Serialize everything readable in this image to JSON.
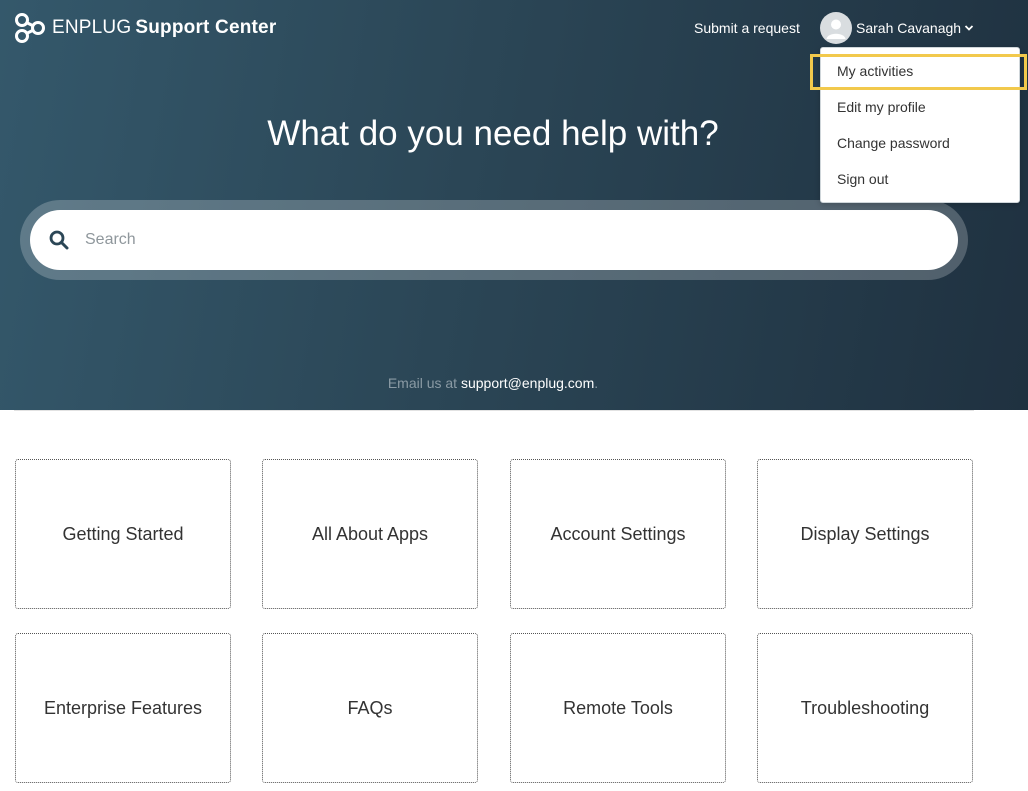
{
  "header": {
    "brand": "ENPLUG",
    "brand_suffix": "Support Center",
    "submit_request": "Submit a request",
    "user_name": "Sarah Cavanagh"
  },
  "user_dropdown": {
    "items": [
      {
        "label": "My activities",
        "highlighted": true
      },
      {
        "label": "Edit my profile"
      },
      {
        "label": "Change password"
      },
      {
        "label": "Sign out"
      }
    ]
  },
  "hero": {
    "title": "What do you need help with?"
  },
  "search": {
    "placeholder": "Search"
  },
  "contact": {
    "prefix": "Email us at ",
    "email": "support@enplug.com",
    "suffix": "."
  },
  "categories": [
    {
      "label": "Getting Started"
    },
    {
      "label": "All About Apps"
    },
    {
      "label": "Account Settings"
    },
    {
      "label": "Display Settings"
    },
    {
      "label": "Enterprise Features"
    },
    {
      "label": "FAQs"
    },
    {
      "label": "Remote Tools"
    },
    {
      "label": "Troubleshooting"
    }
  ],
  "colors": {
    "hero_bg_start": "#34586b",
    "hero_bg_end": "#1f3140",
    "highlight": "#f2c94c"
  },
  "icons": {
    "logo": "enplug-logo-icon",
    "avatar": "user-avatar-icon",
    "chevron": "chevron-down-icon",
    "search": "search-icon"
  }
}
